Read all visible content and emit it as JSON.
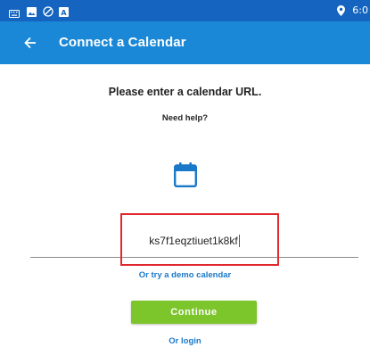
{
  "status_bar": {
    "time": "6:0",
    "icons": [
      "keyboard-icon",
      "image-icon",
      "do-not-disturb-icon",
      "notification-a-icon",
      "location-pin-icon"
    ]
  },
  "app_bar": {
    "title": "Connect a Calendar",
    "back_icon": "arrow-left-icon"
  },
  "main": {
    "prompt": "Please enter a calendar URL.",
    "help_link": "Need help?",
    "calendar_icon": "calendar-icon",
    "url_input": {
      "value": "ks7f1eqztiuet1k8kf"
    },
    "demo_link": "Or try a demo calendar",
    "continue_label": "Continue",
    "login_link": "Or login"
  },
  "colors": {
    "status_bar": "#1565c0",
    "app_bar": "#1a88d6",
    "accent_blue": "#1a78c8",
    "continue_green": "#7cc52a",
    "highlight_red": "#e0282e"
  }
}
